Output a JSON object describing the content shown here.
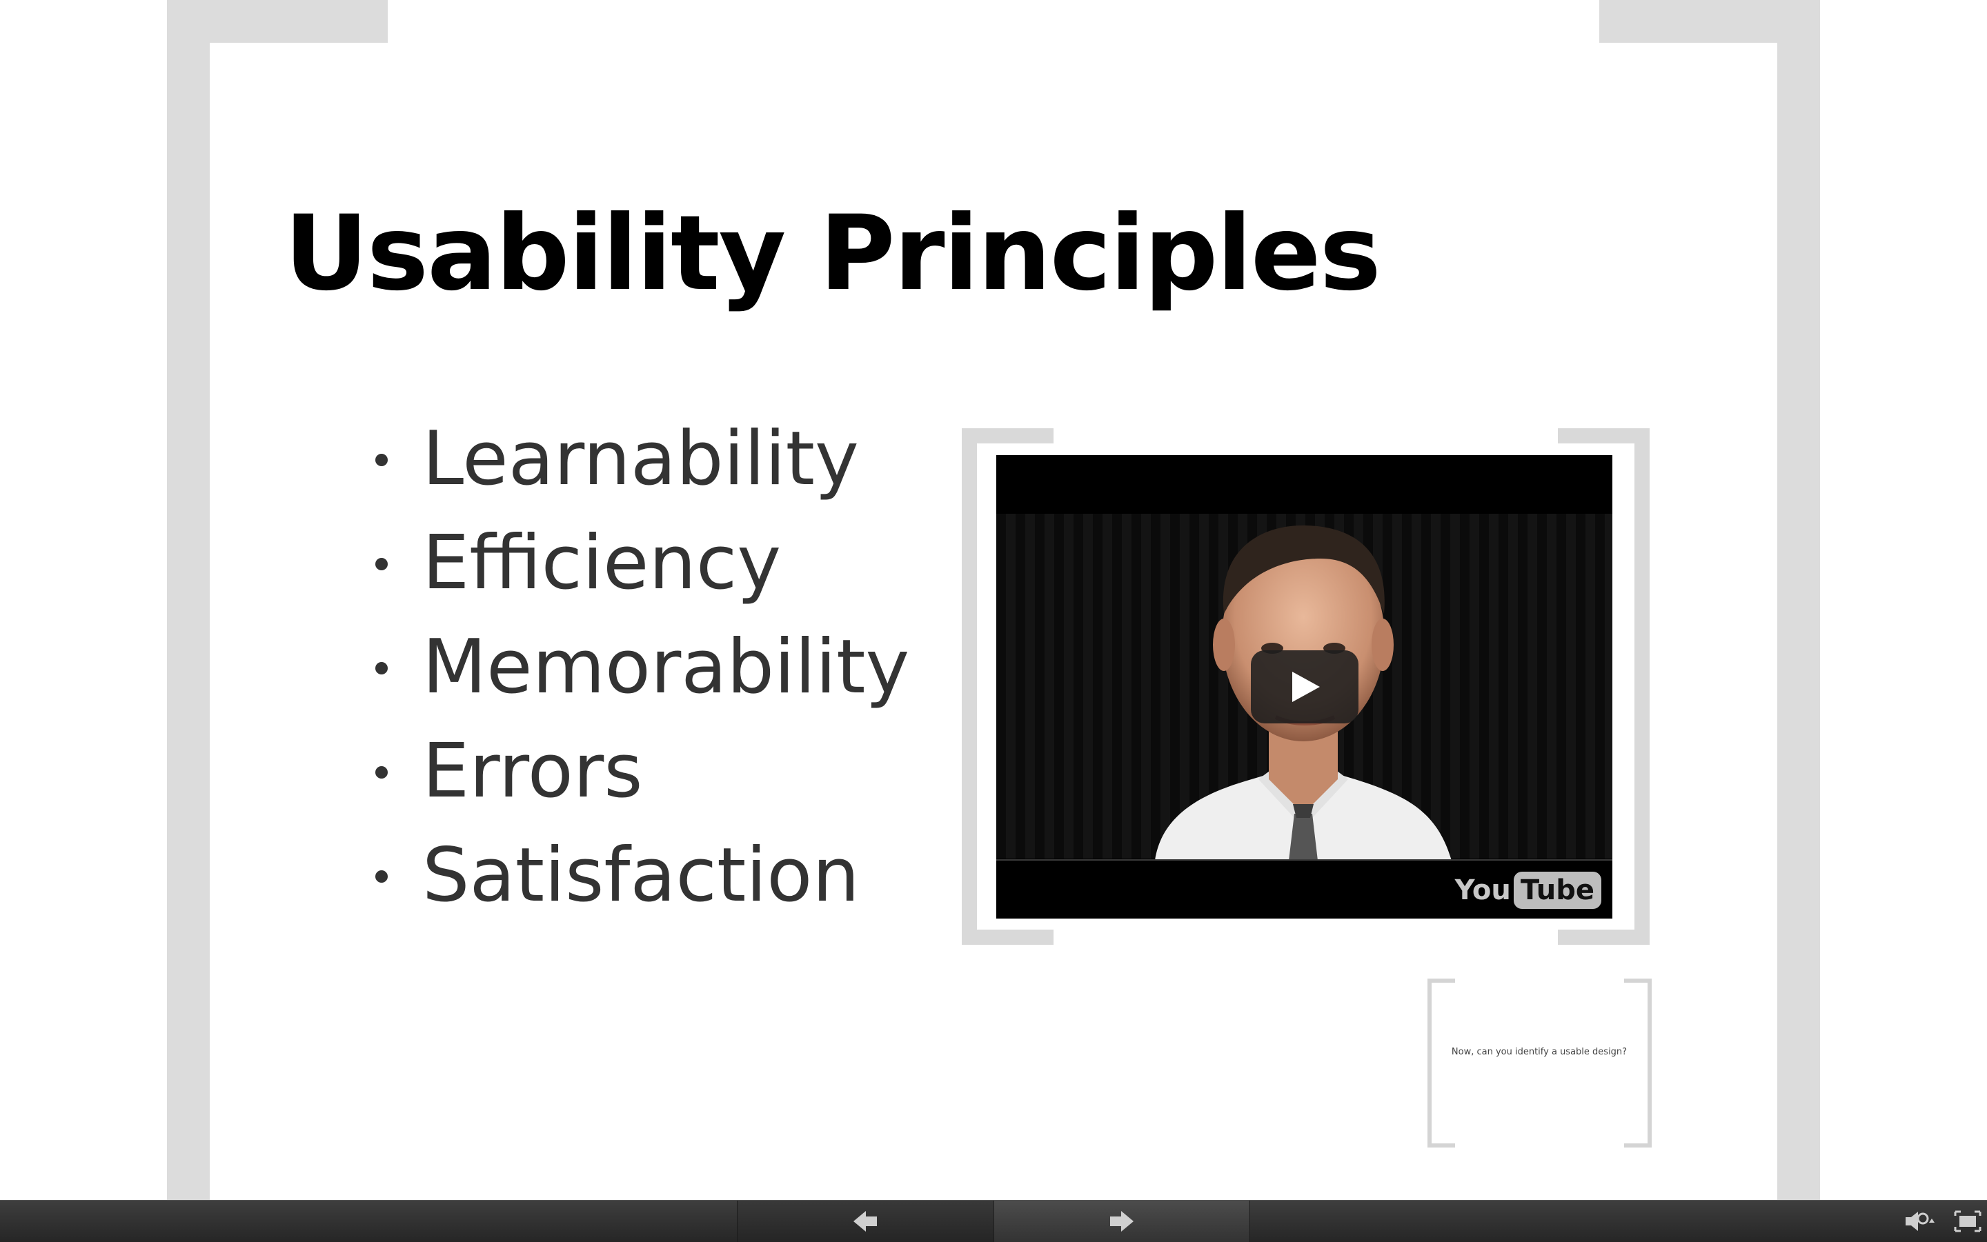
{
  "slide": {
    "title": "Usability Principles",
    "bullets": [
      "Learnability",
      "Efficiency",
      "Memorability",
      "Errors",
      "Satisfaction"
    ]
  },
  "video": {
    "logo_you": "You",
    "logo_tube": "Tube"
  },
  "thumbnail": {
    "text": "Now, can you identify a usable design?"
  },
  "toolbar": {
    "icons": [
      "previous-arrow-icon",
      "next-arrow-icon",
      "audio-settings-icon",
      "fullscreen-icon"
    ]
  }
}
